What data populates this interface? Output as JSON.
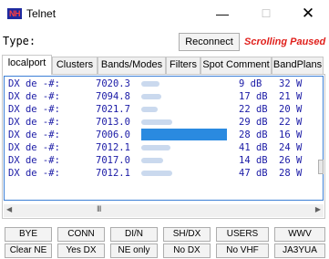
{
  "window": {
    "title": "Telnet",
    "icon_text": "NH",
    "buttons": {
      "minimize": "—",
      "maximize": "☐",
      "close": "✕"
    }
  },
  "toolbar": {
    "type_label": "Type:",
    "reconnect_label": "Reconnect",
    "status_text": "Scrolling Paused",
    "status_color": "#e0201c"
  },
  "tabs": [
    {
      "label": "localport",
      "active": true
    },
    {
      "label": "Clusters",
      "active": false
    },
    {
      "label": "Bands/Modes",
      "active": false
    },
    {
      "label": "Filters",
      "active": false
    },
    {
      "label": "Spot Comment",
      "active": false
    },
    {
      "label": "BandPlans",
      "active": false
    }
  ],
  "spots": [
    {
      "prefix": "DX de -#:",
      "freq": "7020.3",
      "db": "9 dB",
      "wpm": "32 W",
      "selected": false
    },
    {
      "prefix": "DX de -#:",
      "freq": "7094.8",
      "db": "17 dB",
      "wpm": "21 W",
      "selected": false
    },
    {
      "prefix": "DX de -#:",
      "freq": "7021.7",
      "db": "22 dB",
      "wpm": "20 W",
      "selected": false
    },
    {
      "prefix": "DX de -#:",
      "freq": "7013.0",
      "db": "29 dB",
      "wpm": "22 W",
      "selected": false
    },
    {
      "prefix": "DX de -#:",
      "freq": "7006.0",
      "db": "28 dB",
      "wpm": "16 W",
      "selected": true
    },
    {
      "prefix": "DX de -#:",
      "freq": "7012.1",
      "db": "41 dB",
      "wpm": "24 W",
      "selected": false
    },
    {
      "prefix": "DX de -#:",
      "freq": "7017.0",
      "db": "14 dB",
      "wpm": "26 W",
      "selected": false
    },
    {
      "prefix": "DX de -#:",
      "freq": "7012.1",
      "db": "47 dB",
      "wpm": "28 W",
      "selected": false
    }
  ],
  "hscroll": {
    "grip": "III"
  },
  "macros": {
    "row1": [
      "BYE",
      "CONN",
      "DI/N",
      "SH/DX",
      "USERS",
      "WWV"
    ],
    "row2": [
      "Clear NE",
      "Yes DX",
      "NE only",
      "No DX",
      "No VHF",
      "JA3YUA"
    ]
  },
  "colors": {
    "spot_text": "#1a1aa6",
    "selection": "#2a8ae0",
    "console_border": "#3c7fd6"
  }
}
